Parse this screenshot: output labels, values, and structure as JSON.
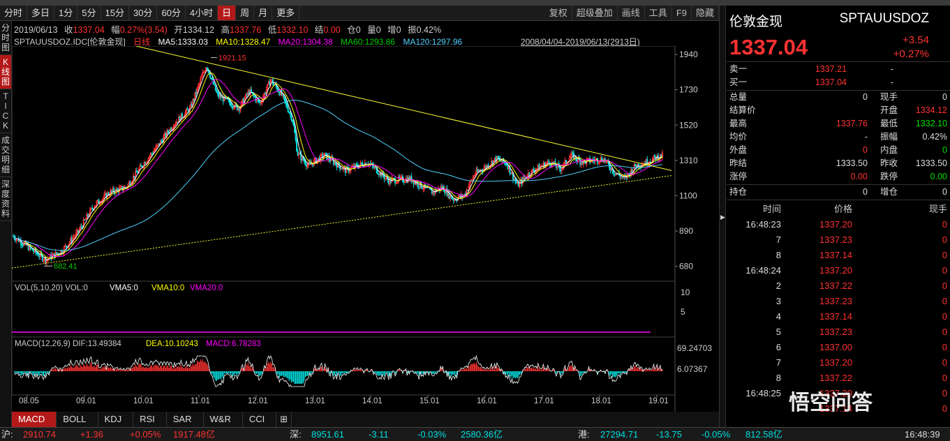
{
  "toolbar": {
    "periods": [
      "分时",
      "多日",
      "1分",
      "5分",
      "15分",
      "30分",
      "60分",
      "4小时",
      "日",
      "周",
      "月",
      "更多"
    ],
    "active": "日",
    "right": [
      "复权",
      "超级叠加",
      "画线",
      "工具",
      "F9",
      "隐藏"
    ]
  },
  "leftbar": {
    "items": [
      "分\n时\n图",
      "K\n线\n图",
      "T\nI\nC\nK",
      "成\n交\n明\n细",
      "深\n度\n资\n料"
    ],
    "active_index": 1
  },
  "info": {
    "date": "2019/06/13",
    "close_label": "收",
    "close": "1337.04",
    "range_label": "幅",
    "range": "0.27%(3.54)",
    "open_label": "开",
    "open": "1334.12",
    "high_label": "高",
    "high": "1337.76",
    "low_label": "低",
    "low": "1332.10",
    "settle_label": "结",
    "settle": "0.00",
    "pos_label": "仓",
    "pos": "0",
    "vol_label": "量",
    "vol": "0",
    "inc_label": "增",
    "inc": "0",
    "amp_label": "振",
    "amp": "0.42%"
  },
  "ma": {
    "symbol": "SPTAUUSDOZ.IDC",
    "name": "[伦敦金现]",
    "period": "日线",
    "ma5": "MA5:1333.03",
    "ma10": "MA10:1328.47",
    "ma20": "MA20:1304.38",
    "ma60": "MA60:1293.86",
    "ma120": "MA120:1297.96",
    "daterange": "2008/04/04-2019/06/13(2913日)"
  },
  "colors": {
    "ma5": "#ffffff",
    "ma10": "#ffff00",
    "ma20": "#ff00ff",
    "ma60": "#00cc00",
    "ma120": "#4fd0ff",
    "up": "#ff3232",
    "down": "#00e0e0",
    "trend": "#ffff33"
  },
  "chart_data": {
    "type": "candlestick",
    "price_axis": [
      "1940",
      "1730",
      "1520",
      "1310",
      "1100",
      "890",
      "680"
    ],
    "x_ticks": [
      "08.05",
      "09.01",
      "10.01",
      "11.01",
      "12.01",
      "13.01",
      "14.01",
      "15.01",
      "16.01",
      "17.01",
      "18.01",
      "19.01"
    ],
    "high_label": "1921.15",
    "low_label": "682.41",
    "close_path": [
      [
        0,
        860
      ],
      [
        6,
        720
      ],
      [
        9,
        770
      ],
      [
        12,
        880
      ],
      [
        15,
        1040
      ],
      [
        18,
        1120
      ],
      [
        21,
        1150
      ],
      [
        24,
        1280
      ],
      [
        27,
        1400
      ],
      [
        30,
        1530
      ],
      [
        33,
        1620
      ],
      [
        36,
        1880
      ],
      [
        38,
        1700
      ],
      [
        40,
        1660
      ],
      [
        42,
        1620
      ],
      [
        44,
        1720
      ],
      [
        46,
        1650
      ],
      [
        48,
        1790
      ],
      [
        50,
        1700
      ],
      [
        52,
        1560
      ],
      [
        53,
        1350
      ],
      [
        55,
        1280
      ],
      [
        58,
        1340
      ],
      [
        62,
        1250
      ],
      [
        66,
        1300
      ],
      [
        70,
        1190
      ],
      [
        74,
        1200
      ],
      [
        78,
        1120
      ],
      [
        80,
        1150
      ],
      [
        82,
        1080
      ],
      [
        84,
        1100
      ],
      [
        86,
        1230
      ],
      [
        88,
        1270
      ],
      [
        90,
        1320
      ],
      [
        92,
        1290
      ],
      [
        94,
        1160
      ],
      [
        96,
        1230
      ],
      [
        98,
        1270
      ],
      [
        100,
        1300
      ],
      [
        102,
        1260
      ],
      [
        104,
        1340
      ],
      [
        106,
        1300
      ],
      [
        108,
        1310
      ],
      [
        110,
        1320
      ],
      [
        112,
        1240
      ],
      [
        114,
        1200
      ],
      [
        116,
        1280
      ],
      [
        118,
        1300
      ],
      [
        120,
        1330
      ],
      [
        121,
        1337
      ]
    ],
    "volume_axis": [
      "10",
      "5"
    ],
    "macd_axis": [
      "69.24703",
      "6.07367"
    ],
    "vol_title": "VOL(5,10,20) VOL:0",
    "vma5": "VMA5:0",
    "vma10": "VMA10:0",
    "vma20": "VMA20:0",
    "macd_title": "MACD(12,26,9) DIF:13.49384",
    "dea": "DEA:10.10243",
    "macd": "MACD:6.78283"
  },
  "right": {
    "name": "伦敦金现",
    "code": "SPTAUUSDOZ",
    "price": "1337.04",
    "chg": "+3.54",
    "pct": "+0.27%",
    "sell1": [
      "卖一",
      "1337.21",
      "-"
    ],
    "buy1": [
      "买一",
      "1337.04",
      "-"
    ],
    "stats": [
      [
        "总量",
        "0",
        "现手",
        "0"
      ],
      [
        "结算价",
        "",
        "开盘",
        "1334.12"
      ],
      [
        "最高",
        "1337.76",
        "最低",
        "1332.10"
      ],
      [
        "均价",
        "-",
        "振幅",
        "0.42%"
      ],
      [
        "外盘",
        "0",
        "内盘",
        "0"
      ],
      [
        "昨结",
        "1333.50",
        "昨收",
        "1333.50"
      ],
      [
        "涨停",
        "0.00",
        "跌停",
        "0.00"
      ],
      [
        "持仓",
        "0",
        "增仓",
        "0"
      ]
    ],
    "tick_header": [
      "时间",
      "价格",
      "现手"
    ],
    "ticks": [
      [
        "16:48:23",
        "1337.20",
        "0"
      ],
      [
        "7",
        "1337.23",
        "0"
      ],
      [
        "8",
        "1337.14",
        "0"
      ],
      [
        "16:48:24",
        "1337.20",
        "0"
      ],
      [
        "2",
        "1337.22",
        "0"
      ],
      [
        "3",
        "1337.23",
        "0"
      ],
      [
        "4",
        "1337.14",
        "0"
      ],
      [
        "5",
        "1337.23",
        "0"
      ],
      [
        "6",
        "1337.00",
        "0"
      ],
      [
        "7",
        "1337.20",
        "0"
      ],
      [
        "8",
        "1337.22",
        "0"
      ],
      [
        "16:48:25",
        "1337.20",
        "0"
      ],
      [
        "",
        "1337.14",
        "0"
      ]
    ]
  },
  "bottomtabs": [
    "MACD",
    "BOLL",
    "KDJ",
    "RSI",
    "SAR",
    "W&R",
    "CCI"
  ],
  "status": {
    "sh_label": "沪:",
    "sh": "2910.74",
    "sh_chg": "+1.36",
    "sh_pct": "+0.05%",
    "sh_amt": "1917.48亿",
    "sz_label": "深:",
    "sz": "8951.61",
    "sz_chg": "-3.11",
    "sz_pct": "-0.03%",
    "sz_amt": "2580.36亿",
    "hk_label": "港:",
    "hk": "27294.71",
    "hk_chg": "-13.75",
    "hk_pct": "-0.05%",
    "hk_amt": "812.58亿",
    "time": "16:48:39"
  },
  "watermark": "悟空问答"
}
